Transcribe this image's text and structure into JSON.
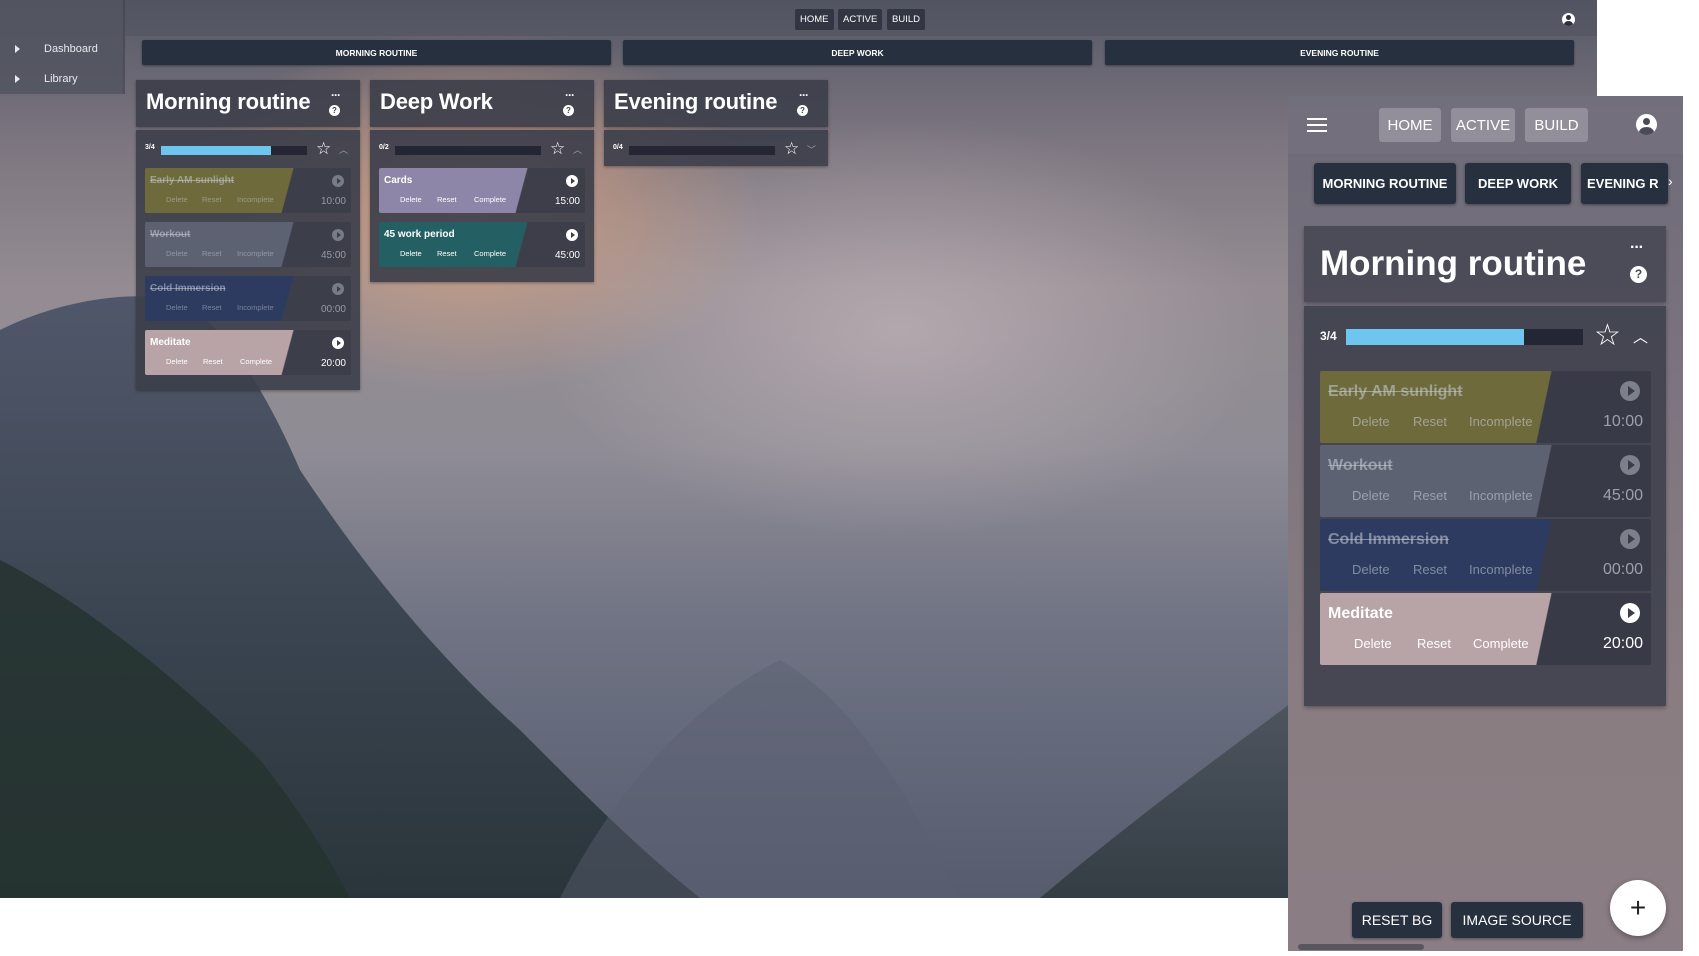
{
  "sidebar": {
    "items": [
      {
        "label": "Dashboard"
      },
      {
        "label": "Library"
      }
    ]
  },
  "nav": {
    "home": "HOME",
    "active": "ACTIVE",
    "build": "BUILD"
  },
  "routine_tabs": [
    "MORNING ROUTINE",
    "DEEP WORK",
    "EVENING ROUTINE"
  ],
  "routines": [
    {
      "title": "Morning routine",
      "progress": "3/4",
      "progress_fraction": 0.75,
      "tasks": [
        {
          "name": "Early AM sunlight",
          "time": "10:00",
          "done": true,
          "actions": [
            "Delete",
            "Reset",
            "Incomplete"
          ],
          "color": "#6e6a3c"
        },
        {
          "name": "Workout",
          "time": "45:00",
          "done": true,
          "actions": [
            "Delete",
            "Reset",
            "Incomplete"
          ],
          "color": "#5c6272"
        },
        {
          "name": "Cold Immersion",
          "time": "00:00",
          "done": true,
          "actions": [
            "Delete",
            "Reset",
            "Incomplete"
          ],
          "color": "#2d3b60"
        },
        {
          "name": "Meditate",
          "time": "20:00",
          "done": false,
          "actions": [
            "Delete",
            "Reset",
            "Complete"
          ],
          "color": "#b8a3a6"
        }
      ]
    },
    {
      "title": "Deep Work",
      "progress": "0/2",
      "progress_fraction": 0,
      "tasks": [
        {
          "name": "Cards",
          "time": "15:00",
          "done": false,
          "actions": [
            "Delete",
            "Reset",
            "Complete"
          ],
          "color": "#8d86a8"
        },
        {
          "name": "45 work period",
          "time": "45:00",
          "done": false,
          "actions": [
            "Delete",
            "Reset",
            "Complete"
          ],
          "color": "#245f64"
        }
      ]
    },
    {
      "title": "Evening routine",
      "progress": "0/4",
      "progress_fraction": 0,
      "tasks": []
    }
  ],
  "mobile": {
    "tabs": [
      "MORNING ROUTINE",
      "DEEP WORK",
      "EVENING R"
    ],
    "buttons": {
      "reset_bg": "RESET BG",
      "image_source": "IMAGE SOURCE"
    },
    "fab": "+"
  },
  "icons": {
    "star": "star-outline-icon",
    "play": "play-circle-icon",
    "more": "more-dots-icon",
    "help": "help-icon",
    "account": "account-circle-icon",
    "menu": "hamburger-icon",
    "add": "plus-icon"
  },
  "colors": {
    "progress": "#6ec6ef",
    "tab_bg": "#27303f",
    "panel_bg": "#3c3e4a"
  }
}
